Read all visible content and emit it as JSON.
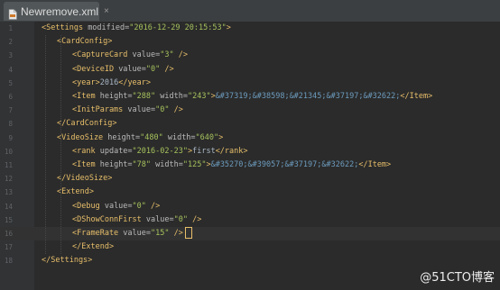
{
  "tab": {
    "label": "Newremove.xml",
    "close": "×",
    "file_icon": "xml-file-icon"
  },
  "lines": [
    {
      "n": "1",
      "indent": 0,
      "parts": [
        [
          "tag",
          "<Settings "
        ],
        [
          "attr",
          "modified="
        ],
        [
          "val",
          "\"2016-12-29 20:15:53\""
        ],
        [
          "tag",
          ">"
        ]
      ]
    },
    {
      "n": "2",
      "indent": 1,
      "parts": [
        [
          "tag",
          "<CardConfig>"
        ]
      ]
    },
    {
      "n": "3",
      "indent": 2,
      "parts": [
        [
          "tag",
          "<CaptureCard "
        ],
        [
          "attr",
          "value="
        ],
        [
          "val",
          "\"3\""
        ],
        [
          "tag",
          " />"
        ]
      ]
    },
    {
      "n": "4",
      "indent": 2,
      "parts": [
        [
          "tag",
          "<DeviceID "
        ],
        [
          "attr",
          "value="
        ],
        [
          "val",
          "\"0\""
        ],
        [
          "tag",
          " />"
        ]
      ]
    },
    {
      "n": "5",
      "indent": 2,
      "parts": [
        [
          "tag",
          "<year>"
        ],
        [
          "txt",
          "2016"
        ],
        [
          "tag",
          "</year>"
        ]
      ]
    },
    {
      "n": "6",
      "indent": 2,
      "parts": [
        [
          "tag",
          "<Item "
        ],
        [
          "attr",
          "height="
        ],
        [
          "val",
          "\"288\""
        ],
        [
          "attr",
          " width="
        ],
        [
          "val",
          "\"243\""
        ],
        [
          "tag",
          ">"
        ],
        [
          "ent",
          "&#37319;&#38598;&#21345;&#37197;&#32622;"
        ],
        [
          "tag",
          "</Item>"
        ]
      ]
    },
    {
      "n": "7",
      "indent": 2,
      "parts": [
        [
          "tag",
          "<InitParams "
        ],
        [
          "attr",
          "value="
        ],
        [
          "val",
          "\"0\""
        ],
        [
          "tag",
          " />"
        ]
      ]
    },
    {
      "n": "8",
      "indent": 1,
      "parts": [
        [
          "tag",
          "</CardConfig>"
        ]
      ]
    },
    {
      "n": "9",
      "indent": 1,
      "parts": [
        [
          "tag",
          "<VideoSize "
        ],
        [
          "attr",
          "height="
        ],
        [
          "val",
          "\"480\""
        ],
        [
          "attr",
          " width="
        ],
        [
          "val",
          "\"640\""
        ],
        [
          "tag",
          ">"
        ]
      ]
    },
    {
      "n": "10",
      "indent": 2,
      "parts": [
        [
          "tag",
          "<rank "
        ],
        [
          "attr",
          "update="
        ],
        [
          "val",
          "\"2016-02-23\""
        ],
        [
          "tag",
          ">"
        ],
        [
          "txt",
          "first"
        ],
        [
          "tag",
          "</rank>"
        ]
      ]
    },
    {
      "n": "11",
      "indent": 2,
      "parts": [
        [
          "tag",
          "<Item "
        ],
        [
          "attr",
          "height="
        ],
        [
          "val",
          "\"78\""
        ],
        [
          "attr",
          " width="
        ],
        [
          "val",
          "\"125\""
        ],
        [
          "tag",
          ">"
        ],
        [
          "ent",
          "&#35270;&#39057;&#37197;&#32622;"
        ],
        [
          "tag",
          "</Item>"
        ]
      ]
    },
    {
      "n": "12",
      "indent": 1,
      "parts": [
        [
          "tag",
          "</VideoSize>"
        ]
      ]
    },
    {
      "n": "13",
      "indent": 1,
      "parts": [
        [
          "tag",
          "<Extend>"
        ]
      ]
    },
    {
      "n": "14",
      "indent": 2,
      "parts": [
        [
          "tag",
          "<Debug "
        ],
        [
          "attr",
          "value="
        ],
        [
          "val",
          "\"0\""
        ],
        [
          "tag",
          " />"
        ]
      ]
    },
    {
      "n": "15",
      "indent": 2,
      "parts": [
        [
          "tag",
          "<DShowConnFirst "
        ],
        [
          "attr",
          "value="
        ],
        [
          "val",
          "\"0\""
        ],
        [
          "tag",
          " />"
        ]
      ]
    },
    {
      "n": "16",
      "indent": 2,
      "parts": [
        [
          "tag",
          "<FrameRate "
        ],
        [
          "attr",
          "value="
        ],
        [
          "val",
          "\"15\""
        ],
        [
          "tag",
          " />"
        ]
      ],
      "current": true
    },
    {
      "n": "17",
      "indent": 2,
      "parts": [
        [
          "tag",
          "</Extend>"
        ]
      ]
    },
    {
      "n": "18",
      "indent": 0,
      "parts": [
        [
          "tag",
          "</Settings>"
        ]
      ]
    }
  ],
  "watermark": "@51CTO博客",
  "colors": {
    "tag": "#e8bf6a",
    "attr": "#bababa",
    "val": "#a5c25c",
    "text": "#a9b7c6",
    "entity": "#6d9cbe",
    "background": "#2b2b2b"
  }
}
